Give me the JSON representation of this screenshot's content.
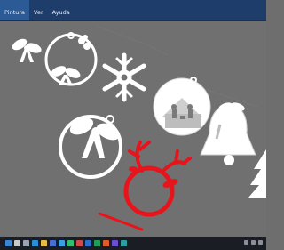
{
  "menu": {
    "items": [
      "Pintura",
      "Ver",
      "Ayuda"
    ]
  },
  "colors": {
    "menubar": "#1f3d6b",
    "menu_active": "#2c5a94",
    "viewport": "#707070",
    "ornament_white": "#ffffff",
    "ornament_red": "#e8141c",
    "taskbar": "#1b1d24"
  },
  "viewport": {
    "objects": [
      "bow-ornament-small",
      "wreath-ornament",
      "snowflake-ornament",
      "nativity-ornament",
      "bell-ornament",
      "bow-ornament-large",
      "reindeer-ornament",
      "tree-ornament"
    ]
  },
  "taskbar": {
    "icons": [
      "start-icon",
      "search-icon",
      "task-view-icon",
      "edge-icon",
      "explorer-icon",
      "store-icon",
      "mail-icon",
      "app-icon-1",
      "app-icon-2",
      "app-icon-3",
      "app-icon-4",
      "app-icon-5",
      "app-icon-6",
      "app-icon-7"
    ]
  }
}
